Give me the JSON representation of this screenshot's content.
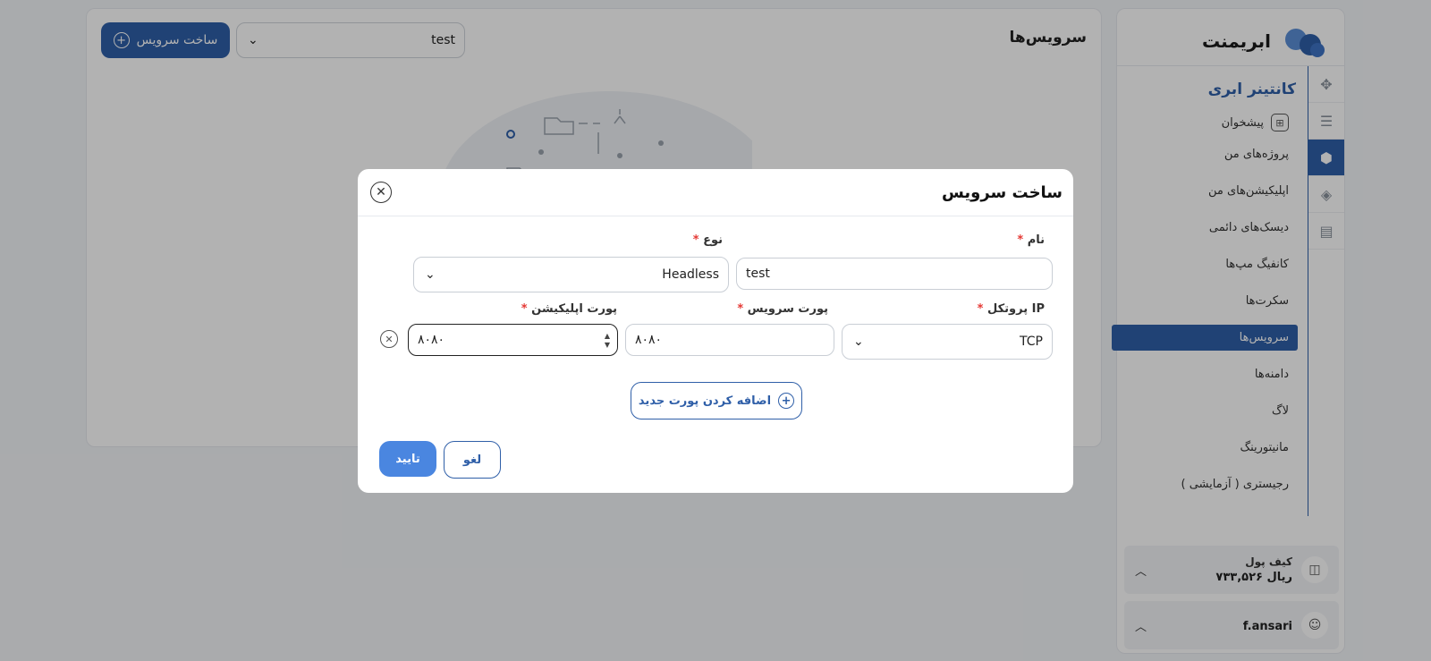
{
  "sidebar": {
    "logo_text": "ابریمنت",
    "section_title": "کانتینر ابری",
    "dashboard_label": "پیشخوان",
    "items": [
      {
        "label": "پروژه‌های من"
      },
      {
        "label": "اپلیکیشن‌های من"
      },
      {
        "label": "دیسک‌های دائمی"
      },
      {
        "label": "کانفیگ مپ‌ها"
      },
      {
        "label": "سکرت‌ها"
      },
      {
        "label": "سرویس‌ها",
        "active": true
      },
      {
        "label": "دامنه‌ها"
      },
      {
        "label": "لاگ"
      },
      {
        "label": "مانیتورینگ"
      },
      {
        "label": "رجیستری ( آزمایشی )"
      }
    ],
    "wallet": {
      "label": "کیف پول",
      "amount": "۷۳۳,۵۲۶ ریال"
    },
    "user": {
      "name": "f.ansari"
    }
  },
  "main": {
    "title": "سرویس‌ها",
    "project_select_value": "test",
    "create_button_label": "ساخت سرویس"
  },
  "modal": {
    "title": "ساخت سرویس",
    "name_label": "نام",
    "name_value": "test",
    "type_label": "نوع",
    "type_value": "Headless",
    "protocol_label": "پروتکل IP",
    "protocol_value": "TCP",
    "service_port_label": "پورت سرویس",
    "service_port_value": "۸۰۸۰",
    "app_port_label": "پورت اپلیکیشن",
    "app_port_value": "۸۰۸۰",
    "required_mark": "*",
    "add_port_label": "اضافه کردن پورت جدید",
    "cancel_label": "لغو",
    "confirm_label": "تایید"
  },
  "colors": {
    "primary": "#2f5fa8",
    "confirm": "#4a86e0",
    "required": "#e53935",
    "overlay": "rgba(0,0,0,0.30)"
  }
}
